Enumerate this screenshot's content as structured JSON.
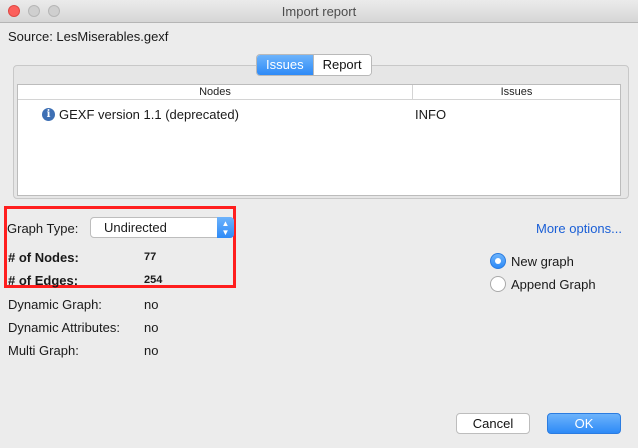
{
  "window": {
    "title": "Import report"
  },
  "source": {
    "text": "Source:  LesMiserables.gexf"
  },
  "tabs": [
    {
      "label": "Issues",
      "active": true
    },
    {
      "label": "Report",
      "active": false
    }
  ],
  "issues_table": {
    "headers": [
      "Nodes",
      "Issues"
    ],
    "rows": [
      {
        "icon": "info-icon",
        "node": "GEXF version 1.1 (deprecated)",
        "issue": "INFO"
      }
    ]
  },
  "graph": {
    "type_label": "Graph Type:",
    "type_value": "Undirected",
    "nodes_label": "# of Nodes:",
    "nodes_value": "77",
    "edges_label": "# of Edges:",
    "edges_value": "254"
  },
  "properties": [
    {
      "label": "Dynamic Graph:",
      "value": "no"
    },
    {
      "label": "Dynamic Attributes:",
      "value": "no"
    },
    {
      "label": "Multi Graph:",
      "value": "no"
    }
  ],
  "more_options": "More options...",
  "mode": [
    {
      "label": "New graph",
      "selected": true
    },
    {
      "label": "Append Graph",
      "selected": false
    }
  ],
  "buttons": {
    "cancel": "Cancel",
    "ok": "OK"
  },
  "colors": {
    "accent": "#2d8af7",
    "highlight": "#ff1e1e",
    "link": "#1a5fd6"
  }
}
